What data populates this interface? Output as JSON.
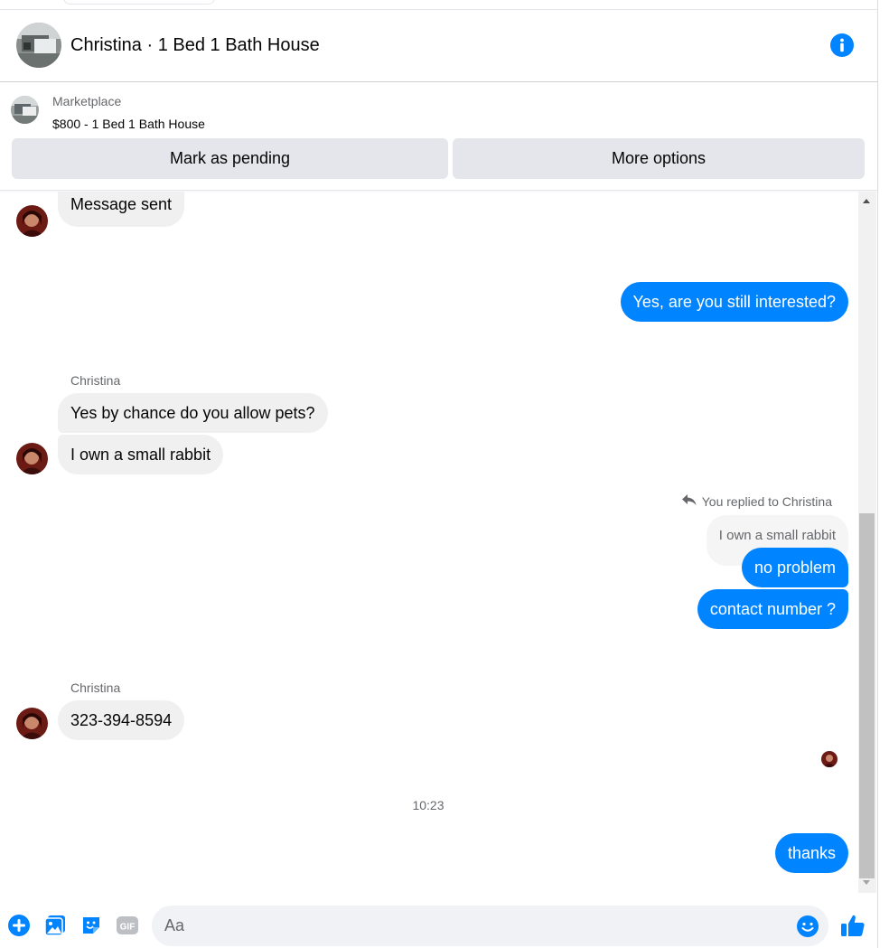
{
  "header": {
    "title": "Christina · 1 Bed 1 Bath House"
  },
  "listing": {
    "label": "Marketplace",
    "description": "$800 - 1 Bed 1 Bath House",
    "mark_pending_label": "Mark as pending",
    "more_options_label": "More options"
  },
  "thread": {
    "msg_sent": "Message sent",
    "out_1": "Yes, are you still interested?",
    "sender_1": "Christina",
    "in_1": "Yes by chance do you allow pets?",
    "in_2": "I own a small rabbit",
    "reply_note": "You replied to Christina",
    "quoted": "I own a small rabbit",
    "out_2": "no problem",
    "out_3": "contact number ?",
    "sender_2": "Christina",
    "in_3": "323-394-8594",
    "timestamp": "10:23",
    "out_4": "thanks"
  },
  "composer": {
    "placeholder": "Aa",
    "icons": [
      "plus-icon",
      "photo-icon",
      "sticker-icon",
      "gif-icon",
      "emoji-icon",
      "thumbs-up-icon"
    ],
    "gif_label": "GIF"
  },
  "colors": {
    "accent": "#0084ff",
    "incoming_bubble": "#f0f0f0",
    "button_bg": "#e4e6eb",
    "muted_text": "#65676b",
    "disabled_icon": "#bcc0c4"
  }
}
